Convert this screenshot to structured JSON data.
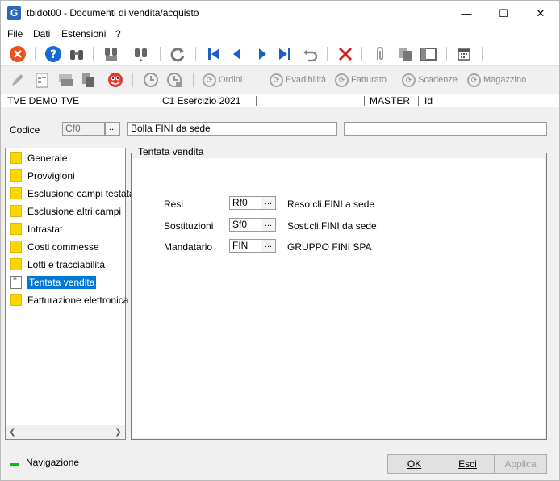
{
  "window": {
    "title": "tbldot00 - Documenti di vendita/acquisto",
    "app_icon_text": "G",
    "minimize": "—",
    "maximize": "☐",
    "close": "✕"
  },
  "menu": {
    "items": [
      "File",
      "Dati",
      "Estensioni",
      "?"
    ]
  },
  "toolbar2": {
    "ordini": "Ordini",
    "evadibilita": "Evadibilità",
    "fatturato": "Fatturato",
    "scadenze": "Scadenze",
    "magazzino": "Magazzino"
  },
  "infobar": {
    "company": "TVE DEMO TVE",
    "exercise": "C1 Esercizio 2021",
    "user": "MASTER",
    "id": "Id"
  },
  "header": {
    "codice_label": "Codice",
    "codice_value": "Cf0",
    "dots": "...",
    "description": "Bolla FINI da sede",
    "extra": ""
  },
  "tree": {
    "items": [
      {
        "label": "Generale",
        "icon": "folder-icon"
      },
      {
        "label": "Provvigioni",
        "icon": "folder-icon"
      },
      {
        "label": "Esclusione campi testata",
        "icon": "folder-icon"
      },
      {
        "label": "Esclusione altri campi",
        "icon": "folder-icon"
      },
      {
        "label": "Intrastat",
        "icon": "folder-icon"
      },
      {
        "label": "Costi commesse",
        "icon": "folder-icon"
      },
      {
        "label": "Lotti e tracciabilità",
        "icon": "folder-icon"
      },
      {
        "label": "Tentata vendita",
        "icon": "document-icon",
        "selected": true
      },
      {
        "label": "Fatturazione elettronica",
        "icon": "folder-icon"
      }
    ]
  },
  "group": {
    "title": "Tentata vendita",
    "fields": [
      {
        "label": "Resi",
        "code": "Rf0",
        "description": "Reso cli.FINI a sede"
      },
      {
        "label": "Sostituzioni",
        "code": "Sf0",
        "description": "Sost.cli.FINI da sede"
      },
      {
        "label": "Mandatario",
        "code": "FIN",
        "description": "GRUPPO FINI SPA"
      }
    ]
  },
  "footer": {
    "navigation": "Navigazione",
    "ok": "OK",
    "esci": "Esci",
    "applica": "Applica"
  },
  "colors": {
    "selection": "#0078d7",
    "nav_indicator": "#00c000",
    "folder": "#ffd700"
  }
}
